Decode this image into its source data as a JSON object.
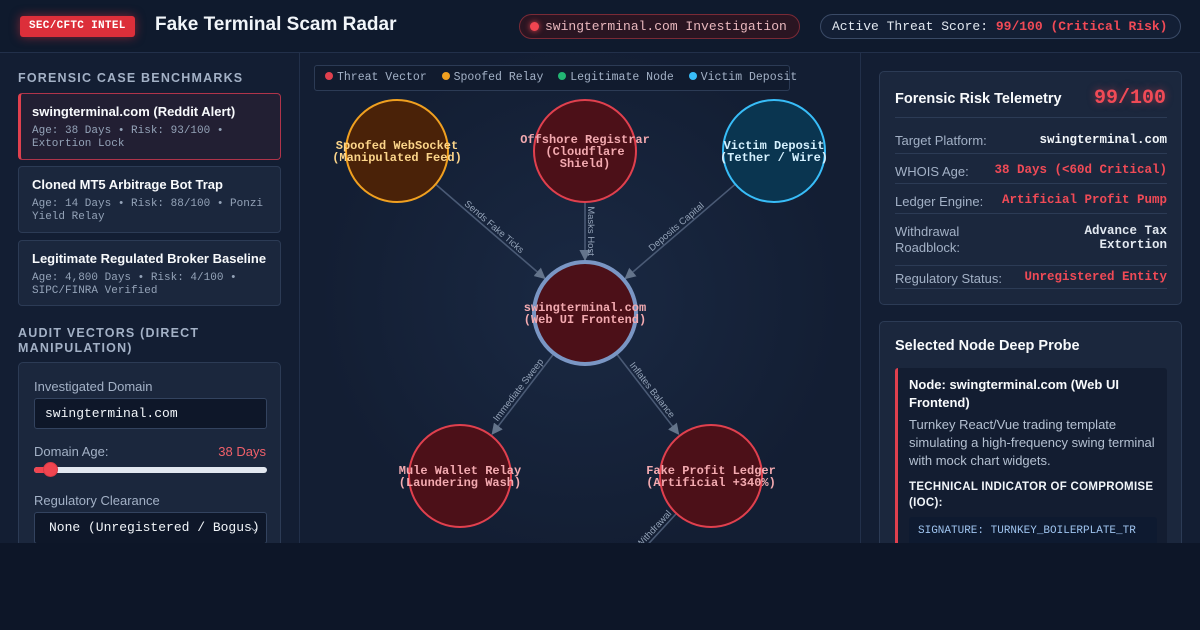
{
  "header": {
    "badge": "SEC/CFTC INTEL",
    "title": "Fake Terminal Scam Radar",
    "investigation": "swingterminal.com Investigation",
    "threat_label": "Active Threat Score:",
    "threat_value": "99/100 (Critical Risk)"
  },
  "benchmarks": {
    "title": "Forensic Case Benchmarks",
    "items": [
      {
        "name": "swingterminal.com (Reddit Alert)",
        "meta": "Age: 38 Days • Risk: 93/100 • Extortion Lock",
        "active": true
      },
      {
        "name": "Cloned MT5 Arbitrage Bot Trap",
        "meta": "Age: 14 Days • Risk: 88/100 • Ponzi Yield Relay",
        "active": false
      },
      {
        "name": "Legitimate Regulated Broker Baseline",
        "meta": "Age: 4,800 Days • Risk: 4/100 • SIPC/FINRA Verified",
        "active": false
      }
    ]
  },
  "audit": {
    "title": "Audit Vectors (Direct Manipulation)",
    "domain_label": "Investigated Domain",
    "domain_value": "swingterminal.com",
    "age_label": "Domain Age:",
    "age_value": "38 Days",
    "age_fraction": 0.07,
    "reg_label": "Regulatory Clearance",
    "reg_value": "None (Unregistered / Bogus)"
  },
  "legend": [
    {
      "label": "Threat Vector",
      "color": "#e0404e"
    },
    {
      "label": "Spoofed Relay",
      "color": "#f0a020"
    },
    {
      "label": "Legitimate Node",
      "color": "#22b573"
    },
    {
      "label": "Victim Deposit",
      "color": "#38bdf8"
    }
  ],
  "graph": {
    "nodes": [
      {
        "id": "ws",
        "lines": [
          "Spoofed WebSocket",
          "(Manipulated Feed)"
        ],
        "type": "spoofed"
      },
      {
        "id": "reg",
        "lines": [
          "Offshore Registrar",
          "(Cloudflare",
          "Shield)"
        ],
        "type": "threat"
      },
      {
        "id": "dep",
        "lines": [
          "Victim Deposit",
          "(Tether / Wire)"
        ],
        "type": "victim"
      },
      {
        "id": "core",
        "lines": [
          "swingterminal.com",
          "(Web UI Frontend)"
        ],
        "type": "core"
      },
      {
        "id": "mule",
        "lines": [
          "Mule Wallet Relay",
          "(Laundering Wash)"
        ],
        "type": "threat"
      },
      {
        "id": "ledger",
        "lines": [
          "Fake Profit Ledger",
          "(Artificial +340%)"
        ],
        "type": "threat"
      }
    ],
    "edges": [
      {
        "from": "ws",
        "to": "core",
        "label": "Sends Fake Ticks"
      },
      {
        "from": "reg",
        "to": "core",
        "label": "Masks Host"
      },
      {
        "from": "dep",
        "to": "core",
        "label": "Deposits Capital"
      },
      {
        "from": "core",
        "to": "mule",
        "label": "Immediate Sweep"
      },
      {
        "from": "core",
        "to": "ledger",
        "label": "Inflates Balance"
      },
      {
        "from": "ledger",
        "to": "offscreen",
        "label": "Withdrawal"
      }
    ],
    "colors": {
      "threat": {
        "fill": "#4c1018",
        "stroke": "#e0404e",
        "text": "#f3aab0"
      },
      "spoofed": {
        "fill": "#4a2208",
        "stroke": "#f0a020",
        "text": "#fcd58a"
      },
      "victim": {
        "fill": "#0a3550",
        "stroke": "#38bdf8",
        "text": "#d6f1ff"
      },
      "core": {
        "fill": "#4c1018",
        "stroke": "#7a96c4",
        "text": "#f3aab0"
      }
    }
  },
  "telemetry": {
    "title": "Forensic Risk Telemetry",
    "score": "99/100",
    "rows": [
      {
        "key": "Target Platform:",
        "value": "swingterminal.com",
        "color": "#f1f5f9"
      },
      {
        "key": "WHOIS Age:",
        "value": "38 Days (<60d Critical)",
        "color": "#f04a56"
      },
      {
        "key": "Ledger Engine:",
        "value": "Artificial Profit Pump",
        "color": "#f04a56"
      },
      {
        "key": "Withdrawal Roadblock:",
        "value": "Advance Tax Extortion",
        "color": "#f04a56"
      },
      {
        "key": "Regulatory Status:",
        "value": "Unregistered Entity",
        "color": "#f04a56"
      }
    ]
  },
  "probe": {
    "title": "Selected Node Deep Probe",
    "node": "Node: swingterminal.com (Web UI Frontend)",
    "description": "Turnkey React/Vue trading template simulating a high-frequency swing terminal with mock chart widgets.",
    "ioc_head": "TECHNICAL INDICATOR OF COMPROMISE (IOC):",
    "ioc_code": "SIGNATURE: TURNKEY_BOILERPLATE_TR"
  }
}
